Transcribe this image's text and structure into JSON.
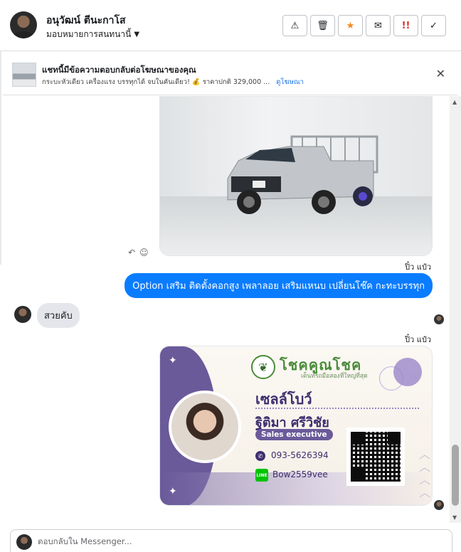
{
  "header": {
    "contact_name": "อนุวัฒน์ ตีนะกาโส",
    "assign_label": "มอบหมายการสนทนานี้",
    "toolbar": [
      {
        "name": "spam-button",
        "icon": "warning-icon",
        "glyph": "⚠"
      },
      {
        "name": "delete-button",
        "icon": "trash-icon",
        "glyph": "🗑"
      },
      {
        "name": "star-button",
        "icon": "star-icon",
        "glyph": "★"
      },
      {
        "name": "mark-unread-button",
        "icon": "envelope-icon",
        "glyph": "✉"
      },
      {
        "name": "follow-up-button",
        "icon": "exclamation-icon",
        "glyph": "!!"
      },
      {
        "name": "mark-done-button",
        "icon": "check-icon",
        "glyph": "✓"
      }
    ]
  },
  "ad": {
    "title": "แชทนี้มีข้อความตอบกลับต่อโฆษณาของคุณ",
    "subtitle": "กระบะหัวเดียว เครื่องแรง บรรทุกได้ จบในคันเดียว! 💰 ราคาปกติ 329,000 ...",
    "link": "ดูโฆษณา"
  },
  "messages": {
    "seen_label_1": "ปิ๋ว แป๋ว",
    "outgoing_text": "Option เสริม ติดตั้งคอกสูง เพลาลอย เสริมแหนบ เปลี่ยนโช๊ค กะทะบรรทุก",
    "incoming_text": "สวยคับ",
    "seen_label_2": "ปิ๋ว แป๋ว"
  },
  "card": {
    "brand": "โชคคูณโชค",
    "brand_tagline": "เต็นท์รถมือสองที่ใหญ่ที่สุด",
    "nickname": "เซลล์โบว์",
    "full_name": "ฐิติมา ศรีวิชัย",
    "role": "Sales executive",
    "phone": "093-5626394",
    "line_badge": "LINE",
    "line_id": "Bow2559vee"
  },
  "composer": {
    "placeholder": "ตอบกลับใน Messenger..."
  },
  "colors": {
    "messenger_blue": "#0a7cff",
    "incoming_gray": "#e4e6eb",
    "card_purple": "#6a5a9a",
    "brand_green": "#4a8b3a"
  }
}
